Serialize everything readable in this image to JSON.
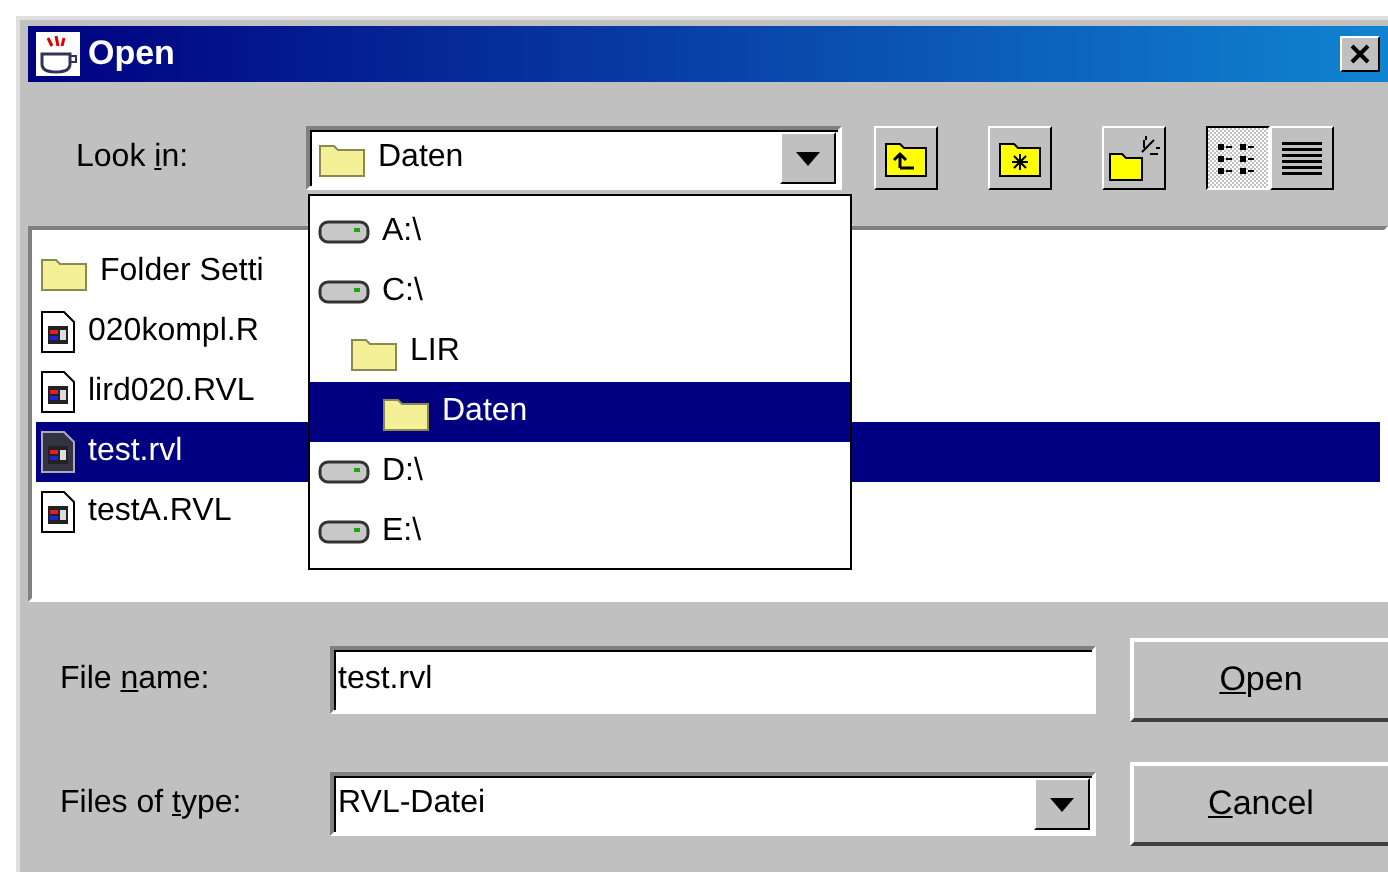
{
  "window": {
    "title": "Open"
  },
  "look_in": {
    "label": {
      "before": "Look ",
      "key": "i",
      "after": "n:"
    },
    "value": "Daten"
  },
  "toolbar": [
    {
      "kind": "up"
    },
    {
      "kind": "new"
    },
    {
      "kind": "home"
    },
    {
      "kind": "list",
      "selected": true
    },
    {
      "kind": "details",
      "selected": false
    }
  ],
  "files": [
    {
      "kind": "folder",
      "name": "Folder Setti",
      "selected": false
    },
    {
      "kind": "file",
      "name": "020kompl.R",
      "selected": false
    },
    {
      "kind": "file",
      "name": "lird020.RVL",
      "selected": false
    },
    {
      "kind": "file",
      "name": "test.rvl",
      "selected": true
    },
    {
      "kind": "file",
      "name": "testA.RVL",
      "selected": false
    }
  ],
  "look_in_menu": [
    {
      "kind": "drive",
      "name": "A:\\",
      "selected": false
    },
    {
      "kind": "drive",
      "name": "C:\\",
      "selected": false,
      "children": [
        {
          "kind": "folder",
          "name": "LIR",
          "selected": false,
          "children": [
            {
              "kind": "folder",
              "name": "Daten",
              "selected": true
            }
          ]
        }
      ]
    },
    {
      "kind": "drive",
      "name": "D:\\",
      "selected": false
    },
    {
      "kind": "drive",
      "name": "E:\\",
      "selected": false
    }
  ],
  "file_name": {
    "label": {
      "before": "File ",
      "key": "n",
      "after": "ame:"
    },
    "value": "test.rvl"
  },
  "file_type": {
    "label": {
      "before": "Files of ",
      "key": "t",
      "after": "ype:"
    },
    "value": "RVL-Datei"
  },
  "buttons": [
    {
      "label": {
        "key": "O",
        "after": "pen"
      }
    },
    {
      "label": {
        "key": "C",
        "after": "ancel"
      }
    }
  ]
}
